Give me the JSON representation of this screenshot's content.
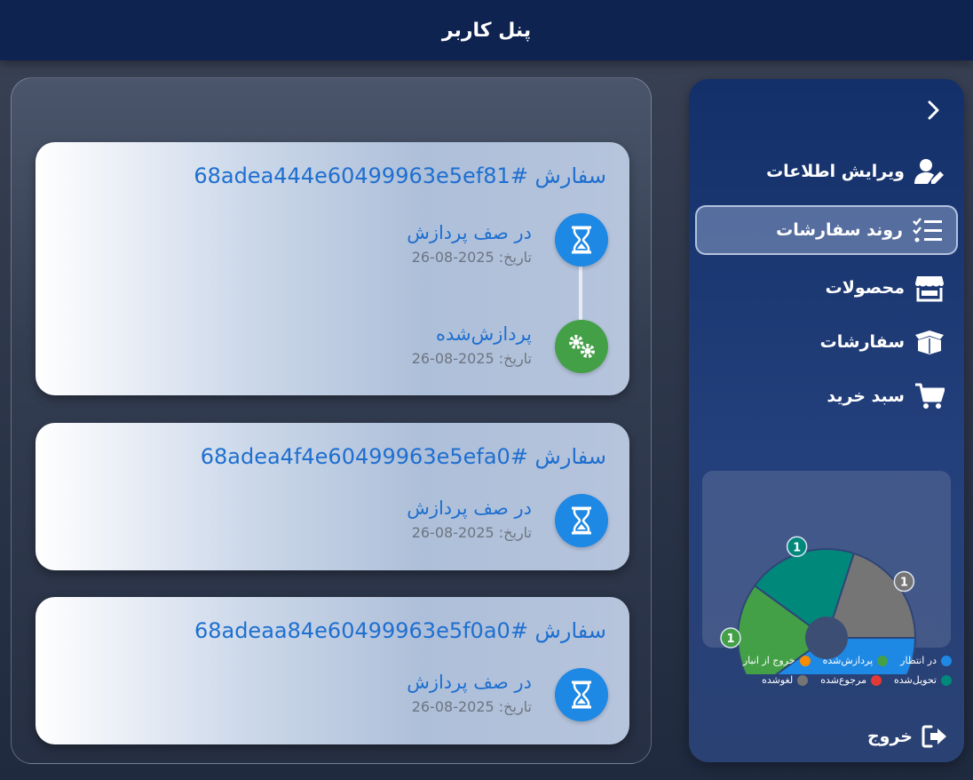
{
  "header": {
    "title": "پنل کاربر"
  },
  "sidebar": {
    "items": [
      {
        "label": "ویرایش اطلاعات",
        "icon": "user-edit-icon"
      },
      {
        "label": "روند سفارشات",
        "icon": "task-list-icon"
      },
      {
        "label": "محصولات",
        "icon": "store-icon"
      },
      {
        "label": "سفارشات",
        "icon": "box-open-icon"
      },
      {
        "label": "سبد خرید",
        "icon": "cart-icon"
      }
    ],
    "logout_label": "خروج",
    "chart_data": {
      "type": "pie",
      "categories": [
        "در انتظار",
        "پردازش‌شده",
        "تحویل‌شده",
        "لغوشده"
      ],
      "values": [
        2,
        1,
        1,
        1
      ],
      "colors": [
        "#1e88e5",
        "#43a047",
        "#00897b",
        "#757575"
      ]
    },
    "legend": [
      {
        "label": "در انتظار",
        "color": "#1e88e5"
      },
      {
        "label": "پردازش‌شده",
        "color": "#43a047"
      },
      {
        "label": "خروج از انبار",
        "color": "#fb8c00"
      },
      {
        "label": "تحویل‌شده",
        "color": "#00897b"
      },
      {
        "label": "مرجوع‌شده",
        "color": "#e53935"
      },
      {
        "label": "لغوشده",
        "color": "#757575"
      }
    ]
  },
  "orders": [
    {
      "title": "سفارش #68adea444e60499963e5ef81",
      "steps": [
        {
          "status": "در صف پردازش",
          "date": "تاریخ: 2025-08-26"
        },
        {
          "status": "پردازش‌شده",
          "date": "تاریخ: 2025-08-26"
        }
      ]
    },
    {
      "title": "سفارش #68adea4f4e60499963e5efa0",
      "steps": [
        {
          "status": "در صف پردازش",
          "date": "تاریخ: 2025-08-26"
        }
      ]
    },
    {
      "title": "سفارش #68adeaa84e60499963e5f0a0",
      "steps": [
        {
          "status": "در صف پردازش",
          "date": "تاریخ: 2025-08-26"
        }
      ]
    }
  ],
  "colors": {
    "accent": "#1e6fd0",
    "pending": "#1e88e5",
    "processed": "#43a047",
    "header": "#0e2350"
  }
}
